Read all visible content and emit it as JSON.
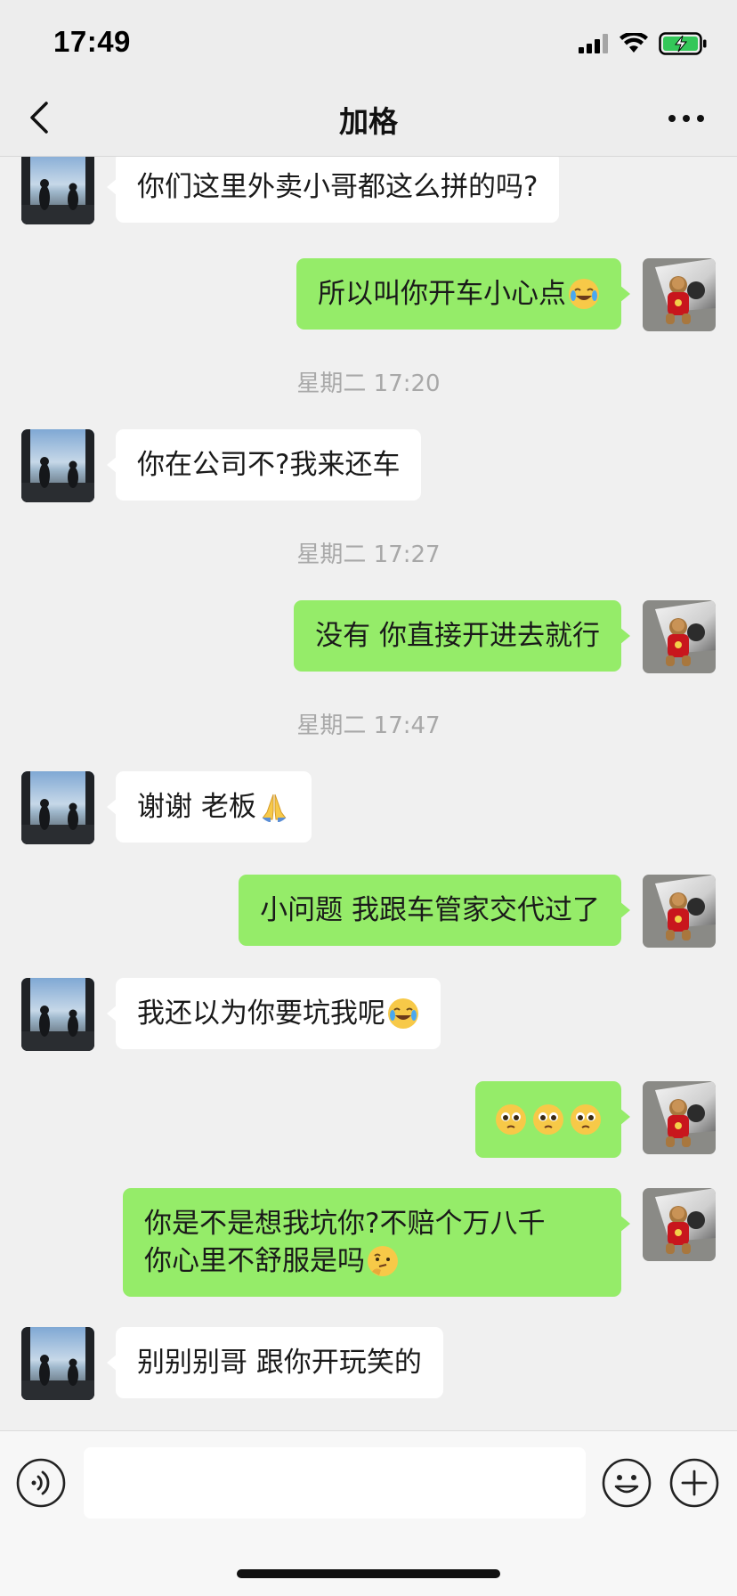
{
  "status_bar": {
    "time": "17:49",
    "battery": "charging"
  },
  "nav": {
    "title": "加格",
    "back_icon": "chevron-left-icon",
    "more_icon": "more-dots-icon"
  },
  "messages": [
    {
      "type": "recv",
      "text": "你们这里外卖小哥都这么拼的吗?"
    },
    {
      "type": "sent",
      "text": "所以叫你开车小心点",
      "emoji": "face-with-tears-of-joy"
    },
    {
      "type": "time",
      "text": "星期二 17:20"
    },
    {
      "type": "recv",
      "text": "你在公司不?我来还车"
    },
    {
      "type": "time",
      "text": "星期二 17:27"
    },
    {
      "type": "sent",
      "text": "没有 你直接开进去就行"
    },
    {
      "type": "time",
      "text": "星期二 17:47"
    },
    {
      "type": "recv",
      "text": "谢谢 老板",
      "emoji": "folded-hands"
    },
    {
      "type": "sent",
      "text": "小问题 我跟车管家交代过了"
    },
    {
      "type": "recv",
      "text": "我还以为你要坑我呢",
      "emoji": "face-with-tears-of-joy"
    },
    {
      "type": "sent",
      "text": "",
      "emoji": "pleading-face x3"
    },
    {
      "type": "sent",
      "lines": [
        "你是不是想我坑你?不赔个万八千",
        "你心里不舒服是吗"
      ],
      "emoji": "thinking-face"
    },
    {
      "type": "recv",
      "text": "别别别哥 跟你开玩笑的"
    }
  ],
  "input_bar": {
    "voice_icon": "voice-icon",
    "emoji_icon": "emoji-icon",
    "plus_icon": "plus-icon",
    "input_value": ""
  },
  "colors": {
    "sent_bubble": "#95ec69",
    "recv_bubble": "#ffffff",
    "background": "#f0f0f0"
  }
}
